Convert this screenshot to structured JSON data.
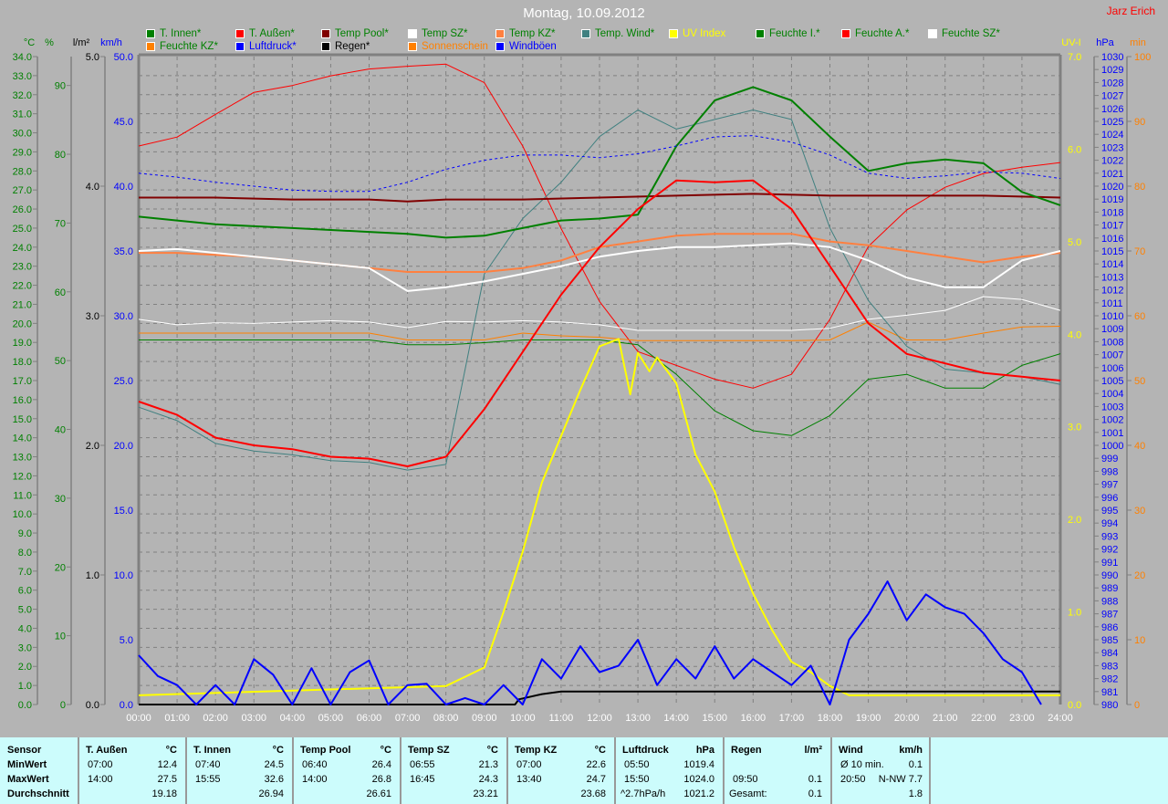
{
  "header": {
    "title": "Montag, 10.09.2012",
    "author": "Jarz Erich"
  },
  "legend": [
    {
      "label": "T. Innen*",
      "color": "#008000",
      "text": "#008000"
    },
    {
      "label": "T. Außen*",
      "color": "#ff0000",
      "text": "#008000"
    },
    {
      "label": "Temp Pool*",
      "color": "#800000",
      "text": "#008000"
    },
    {
      "label": "Temp SZ*",
      "color": "#ffffff",
      "text": "#008000"
    },
    {
      "label": "Temp KZ*",
      "color": "#ff8040",
      "text": "#008000"
    },
    {
      "label": "Temp. Wind*",
      "color": "#408080",
      "text": "#008000"
    },
    {
      "label": "UV Index",
      "color": "#ffff00",
      "text": "#ffff00"
    },
    {
      "label": "Feuchte I.*",
      "color": "#008000",
      "text": "#008000"
    },
    {
      "label": "Feuchte A.*",
      "color": "#ff0000",
      "text": "#008000"
    },
    {
      "label": "Feuchte SZ*",
      "color": "#ffffff",
      "text": "#008000"
    },
    {
      "label": "Feuchte KZ*",
      "color": "#ff8000",
      "text": "#008000"
    },
    {
      "label": "Luftdruck*",
      "color": "#0000ff",
      "text": "#0000ff"
    },
    {
      "label": "Regen*",
      "color": "#000000",
      "text": "#000000"
    },
    {
      "label": "Sonnenschein",
      "color": "#ff8000",
      "text": "#ff8000"
    },
    {
      "label": "Windböen",
      "color": "#0000ff",
      "text": "#0000ff"
    }
  ],
  "chart_data": {
    "type": "line",
    "title": "Montag, 10.09.2012",
    "x_ticks": [
      "00:00",
      "01:00",
      "02:00",
      "03:00",
      "04:00",
      "05:00",
      "06:00",
      "07:00",
      "08:00",
      "09:00",
      "10:00",
      "11:00",
      "12:00",
      "13:00",
      "14:00",
      "15:00",
      "16:00",
      "17:00",
      "18:00",
      "19:00",
      "20:00",
      "21:00",
      "22:00",
      "23:00",
      "24:00"
    ],
    "xlim": [
      0,
      24
    ],
    "axes": {
      "temp": {
        "label": "°C",
        "range": [
          0,
          34
        ],
        "step": 1,
        "decimals": 1,
        "color": "#008000"
      },
      "hum": {
        "label": "%",
        "range": [
          0,
          94.2
        ],
        "step": 10,
        "decimals": 0,
        "color": "#008000"
      },
      "rain": {
        "label": "l/m²",
        "range": [
          0,
          5
        ],
        "step": 1,
        "decimals": 1,
        "color": "#000000"
      },
      "wind": {
        "label": "km/h",
        "range": [
          0,
          50
        ],
        "step": 5,
        "decimals": 1,
        "color": "#0000ff"
      },
      "uv": {
        "label": "UV-I",
        "range": [
          0,
          7
        ],
        "step": 1,
        "decimals": 1,
        "color": "#ffff00"
      },
      "press": {
        "label": "hPa",
        "range": [
          980,
          1030
        ],
        "step": 1,
        "decimals": 0,
        "color": "#0000ff"
      },
      "sun": {
        "label": "min",
        "range": [
          0,
          100
        ],
        "step": 10,
        "decimals": 0,
        "color": "#ff8000"
      }
    },
    "grid": true,
    "series": [
      {
        "name": "Feuchte A.",
        "axis": "hum",
        "color": "#ff0000",
        "width": 1,
        "x": [
          0,
          1,
          2,
          3,
          4,
          5,
          6,
          7,
          8,
          9,
          10,
          11,
          12,
          13,
          14,
          15,
          16,
          17,
          18,
          19,
          20,
          21,
          22,
          23,
          24
        ],
        "values": [
          81.2,
          82.5,
          85.8,
          89,
          90,
          91.4,
          92.4,
          92.8,
          93.1,
          90.4,
          81.2,
          69.2,
          58.6,
          51.3,
          49.3,
          47.3,
          46,
          48,
          56,
          66.6,
          71.9,
          75.2,
          77.2,
          78.1,
          78.8
        ]
      },
      {
        "name": "Feuchte I.",
        "axis": "hum",
        "color": "#008000",
        "width": 1,
        "x": [
          0,
          1,
          2,
          3,
          4,
          5,
          6,
          7,
          8,
          9,
          10,
          11,
          12,
          13,
          14,
          15,
          16,
          17,
          18,
          19,
          20,
          21,
          22,
          23,
          24
        ],
        "values": [
          53,
          53,
          53,
          53,
          53,
          53,
          53,
          52.3,
          52.3,
          52.6,
          53,
          53,
          53,
          52.3,
          48,
          42.7,
          39.8,
          39.1,
          42,
          47.3,
          48,
          46,
          46,
          49.3,
          51
        ]
      },
      {
        "name": "Feuchte SZ",
        "axis": "hum",
        "color": "#ffffff",
        "width": 1,
        "x": [
          0,
          1,
          2,
          3,
          4,
          5,
          6,
          7,
          8,
          9,
          10,
          11,
          12,
          13,
          14,
          15,
          16,
          17,
          18,
          19,
          20,
          21,
          22,
          23,
          24
        ],
        "values": [
          56,
          55.2,
          55.5,
          55.4,
          55.6,
          55.8,
          55.6,
          54.8,
          55.7,
          55.6,
          55.8,
          55.6,
          55.2,
          54.4,
          54.4,
          54.4,
          54.4,
          54.4,
          54.7,
          56,
          56.6,
          57.3,
          59.3,
          58.9,
          57.3
        ]
      },
      {
        "name": "Feuchte KZ",
        "axis": "hum",
        "color": "#ff8000",
        "width": 1,
        "x": [
          0,
          1,
          2,
          3,
          4,
          5,
          6,
          7,
          8,
          9,
          10,
          11,
          12,
          13,
          14,
          15,
          16,
          17,
          18,
          19,
          20,
          21,
          22,
          23,
          24
        ],
        "values": [
          54,
          54,
          54,
          54,
          54,
          54,
          54,
          53,
          53,
          53,
          54,
          53.6,
          53.4,
          52.9,
          52.9,
          52.9,
          52.9,
          52.9,
          53,
          55.6,
          53,
          53,
          54,
          54.9,
          55
        ]
      },
      {
        "name": "Temp. Wind",
        "axis": "temp",
        "color": "#408080",
        "width": 1,
        "x": [
          0,
          1,
          2,
          3,
          4,
          5,
          6,
          7,
          8,
          9,
          10,
          11,
          12,
          13,
          14,
          15,
          16,
          17,
          18,
          19,
          20,
          21,
          22,
          23,
          24
        ],
        "values": [
          15.6,
          14.9,
          13.7,
          13.3,
          13.1,
          12.8,
          12.7,
          12.3,
          12.6,
          22.6,
          25.5,
          27.4,
          29.8,
          31.2,
          30.2,
          30.7,
          31.2,
          30.7,
          25,
          21.2,
          18.8,
          17.6,
          17.4,
          17.2,
          16.8
        ]
      },
      {
        "name": "Temp Pool",
        "axis": "temp",
        "color": "#800000",
        "width": 2,
        "x": [
          0,
          2,
          4,
          6,
          7,
          8,
          10,
          12,
          14,
          16,
          18,
          20,
          22,
          24
        ],
        "values": [
          26.6,
          26.6,
          26.5,
          26.5,
          26.4,
          26.5,
          26.5,
          26.6,
          26.7,
          26.8,
          26.7,
          26.7,
          26.7,
          26.6
        ]
      },
      {
        "name": "Temp KZ",
        "axis": "temp",
        "color": "#ff8040",
        "width": 2,
        "x": [
          0,
          1,
          2,
          3,
          4,
          5,
          6,
          7,
          8,
          9,
          10,
          11,
          12,
          13,
          14,
          15,
          16,
          17,
          18,
          19,
          20,
          21,
          22,
          23,
          24
        ],
        "values": [
          23.7,
          23.7,
          23.6,
          23.5,
          23.3,
          23.1,
          22.9,
          22.7,
          22.7,
          22.7,
          22.9,
          23.3,
          24,
          24.3,
          24.6,
          24.7,
          24.7,
          24.7,
          24.3,
          24.1,
          23.8,
          23.5,
          23.2,
          23.5,
          23.7
        ]
      },
      {
        "name": "Temp SZ",
        "axis": "temp",
        "color": "#ffffff",
        "width": 2,
        "x": [
          0,
          1,
          2,
          3,
          4,
          5,
          6,
          7,
          8,
          9,
          10,
          11,
          12,
          13,
          14,
          15,
          16,
          17,
          18,
          19,
          20,
          21,
          22,
          23,
          24
        ],
        "values": [
          23.8,
          23.9,
          23.7,
          23.5,
          23.3,
          23.1,
          22.9,
          21.7,
          21.9,
          22.2,
          22.6,
          23,
          23.5,
          23.8,
          24,
          24,
          24.1,
          24.2,
          24,
          23.3,
          22.4,
          21.9,
          21.9,
          23.3,
          23.8
        ]
      },
      {
        "name": "T. Innen",
        "axis": "temp",
        "color": "#008000",
        "width": 2,
        "x": [
          0,
          1,
          2,
          3,
          4,
          5,
          6,
          7,
          8,
          9,
          10,
          11,
          12,
          13,
          14,
          15,
          16,
          17,
          18,
          19,
          20,
          21,
          22,
          23,
          24
        ],
        "values": [
          25.6,
          25.4,
          25.2,
          25.1,
          25,
          24.9,
          24.8,
          24.7,
          24.5,
          24.6,
          25,
          25.4,
          25.5,
          25.7,
          29.3,
          31.7,
          32.4,
          31.7,
          29.8,
          28,
          28.4,
          28.6,
          28.4,
          26.9,
          26.2
        ]
      },
      {
        "name": "T. Außen",
        "axis": "temp",
        "color": "#ff0000",
        "width": 2,
        "x": [
          0,
          1,
          2,
          3,
          4,
          5,
          6,
          7,
          8,
          9,
          10,
          11,
          12,
          13,
          14,
          15,
          16,
          17,
          18,
          19,
          20,
          21,
          22,
          23,
          24
        ],
        "values": [
          15.9,
          15.2,
          14.0,
          13.6,
          13.4,
          13.0,
          12.9,
          12.5,
          13.0,
          15.5,
          18.5,
          21.5,
          24.0,
          26.0,
          27.5,
          27.4,
          27.5,
          26.0,
          23.0,
          20.0,
          18.4,
          17.9,
          17.4,
          17.2,
          17.0
        ]
      },
      {
        "name": "Luftdruck",
        "axis": "press",
        "color": "#0000ff",
        "width": 1,
        "dash": true,
        "x": [
          0,
          1,
          2,
          3,
          4,
          5,
          6,
          7,
          8,
          9,
          10,
          11,
          12,
          13,
          14,
          15,
          16,
          17,
          18,
          19,
          20,
          21,
          22,
          23,
          24
        ],
        "values": [
          1021,
          1020.7,
          1020.3,
          1020,
          1019.7,
          1019.6,
          1019.6,
          1020.3,
          1021.3,
          1022,
          1022.4,
          1022.4,
          1022.2,
          1022.5,
          1023.1,
          1023.8,
          1023.9,
          1023.4,
          1022.4,
          1021,
          1020.6,
          1020.8,
          1021.1,
          1021,
          1020.6
        ]
      },
      {
        "name": "UV Index",
        "axis": "uv",
        "color": "#ffff00",
        "width": 2,
        "x": [
          0,
          8,
          8.5,
          9,
          9.5,
          10,
          10.5,
          11,
          11.5,
          12,
          12.5,
          12.8,
          13,
          13.3,
          13.5,
          14,
          14.5,
          15,
          15.5,
          16,
          16.5,
          17,
          17.5,
          18,
          18.5,
          24
        ],
        "values": [
          0.1,
          0.2,
          0.3,
          0.4,
          1.0,
          1.65,
          2.4,
          2.9,
          3.4,
          3.87,
          3.95,
          3.35,
          3.8,
          3.6,
          3.75,
          3.47,
          2.7,
          2.3,
          1.7,
          1.2,
          0.8,
          0.46,
          0.35,
          0.2,
          0.1,
          0.1
        ]
      },
      {
        "name": "Regen",
        "axis": "rain",
        "color": "#000000",
        "width": 2,
        "x": [
          0,
          9.8,
          9.9,
          10.5,
          11,
          24
        ],
        "values": [
          0,
          0,
          0.04,
          0.08,
          0.1,
          0.1
        ]
      },
      {
        "name": "Windböen",
        "axis": "wind",
        "color": "#0000ff",
        "width": 2,
        "x": [
          0,
          0.5,
          1,
          1.5,
          2,
          2.5,
          3,
          3.5,
          4,
          4.5,
          5,
          5.5,
          6,
          6.5,
          7,
          7.5,
          8,
          8.5,
          9,
          9.5,
          10,
          10.5,
          11,
          11.5,
          12,
          12.5,
          13,
          13.5,
          14,
          14.5,
          15,
          15.5,
          16,
          16.5,
          17,
          17.5,
          18,
          18.5,
          19,
          19.5,
          20,
          20.5,
          21,
          21.5,
          22,
          22.5,
          23,
          23.5
        ],
        "values": [
          3.8,
          2.2,
          1.5,
          0,
          1.5,
          0,
          3.5,
          2.3,
          0,
          2.8,
          0,
          2.5,
          3.4,
          0,
          1.5,
          1.6,
          0,
          0.5,
          0,
          1.5,
          0,
          3.5,
          2,
          4.5,
          2.5,
          3,
          5,
          1.5,
          3.5,
          2,
          4.5,
          2,
          3.5,
          2.5,
          1.5,
          3,
          0,
          5,
          7,
          9.5,
          6.5,
          8.5,
          7.5,
          7,
          5.5,
          3.5,
          2.5,
          0
        ]
      }
    ]
  },
  "stats": {
    "row_labels": [
      "Sensor",
      "MinWert",
      "MaxWert",
      "Durchschnitt"
    ],
    "columns": [
      {
        "name": "T. Außen",
        "unit": "°C",
        "min_time": "07:00",
        "min": "12.4",
        "max_time": "14:00",
        "max": "27.5",
        "avg_label": "",
        "avg": "19.18"
      },
      {
        "name": "T. Innen",
        "unit": "°C",
        "min_time": "07:40",
        "min": "24.5",
        "max_time": "15:55",
        "max": "32.6",
        "avg_label": "",
        "avg": "26.94"
      },
      {
        "name": "Temp Pool",
        "unit": "°C",
        "min_time": "06:40",
        "min": "26.4",
        "max_time": "14:00",
        "max": "26.8",
        "avg_label": "",
        "avg": "26.61"
      },
      {
        "name": "Temp SZ",
        "unit": "°C",
        "min_time": "06:55",
        "min": "21.3",
        "max_time": "16:45",
        "max": "24.3",
        "avg_label": "",
        "avg": "23.21"
      },
      {
        "name": "Temp KZ",
        "unit": "°C",
        "min_time": "07:00",
        "min": "22.6",
        "max_time": "13:40",
        "max": "24.7",
        "avg_label": "",
        "avg": "23.68"
      },
      {
        "name": "Luftdruck",
        "unit": "hPa",
        "min_time": "05:50",
        "min": "1019.4",
        "max_time": "15:50",
        "max": "1024.0",
        "avg_label": "^2.7hPa/h",
        "avg": "1021.2"
      },
      {
        "name": "Regen",
        "unit": "l/m²",
        "min_time": "",
        "min": "",
        "max_time": "09:50",
        "max": "0.1",
        "avg_label": "Gesamt:",
        "avg": "0.1"
      },
      {
        "name": "Wind",
        "unit": "km/h",
        "min_time": "Ø 10 min.",
        "min": "0.1",
        "max_time": "20:50",
        "max": "N-NW 7.7",
        "avg_label": "",
        "avg": "1.8"
      }
    ]
  }
}
